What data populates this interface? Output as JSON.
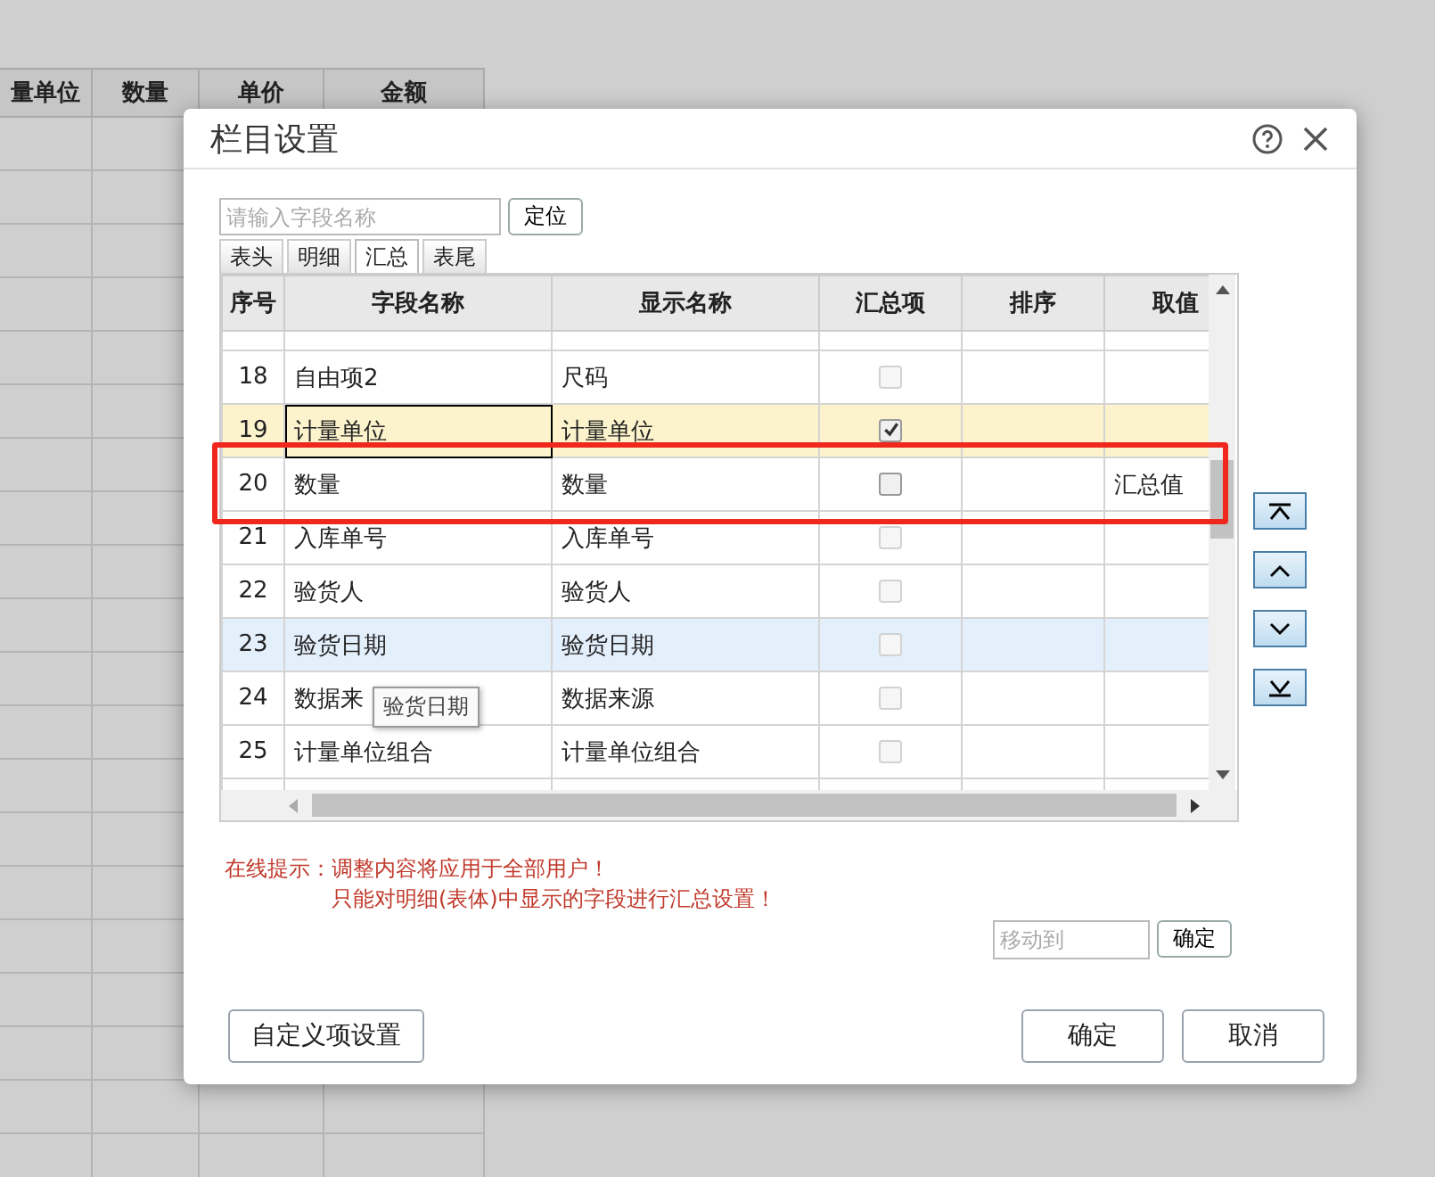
{
  "background_sheet": {
    "columns": [
      "量单位",
      "数量",
      "单价",
      "金额"
    ]
  },
  "dialog": {
    "title": "栏目设置"
  },
  "search": {
    "placeholder": "请输入字段名称",
    "button": "定位"
  },
  "tabs": [
    {
      "label": "表头",
      "selected": false
    },
    {
      "label": "明细",
      "selected": false
    },
    {
      "label": "汇总",
      "selected": true
    },
    {
      "label": "表尾",
      "selected": false
    }
  ],
  "table": {
    "columns": [
      "序号",
      "字段名称",
      "显示名称",
      "汇总项",
      "排序",
      "取值"
    ],
    "rows": [
      {
        "no": "18",
        "field": "自由项2",
        "display": "尺码",
        "checked": false,
        "disabled": true,
        "value": "",
        "selected": false,
        "hovered": false
      },
      {
        "no": "19",
        "field": "计量单位",
        "display": "计量单位",
        "checked": true,
        "disabled": false,
        "value": "",
        "selected": true,
        "hovered": false
      },
      {
        "no": "20",
        "field": "数量",
        "display": "数量",
        "checked": false,
        "disabled": false,
        "value": "汇总值",
        "selected": false,
        "hovered": false
      },
      {
        "no": "21",
        "field": "入库单号",
        "display": "入库单号",
        "checked": false,
        "disabled": true,
        "value": "",
        "selected": false,
        "hovered": false
      },
      {
        "no": "22",
        "field": "验货人",
        "display": "验货人",
        "checked": false,
        "disabled": true,
        "value": "",
        "selected": false,
        "hovered": false
      },
      {
        "no": "23",
        "field": "验货日期",
        "display": "验货日期",
        "checked": false,
        "disabled": true,
        "value": "",
        "selected": false,
        "hovered": true
      },
      {
        "no": "24",
        "field": "数据来",
        "display": "数据来源",
        "checked": false,
        "disabled": true,
        "value": "",
        "selected": false,
        "hovered": false
      },
      {
        "no": "25",
        "field": "计量单位组合",
        "display": "计量单位组合",
        "checked": false,
        "disabled": true,
        "value": "",
        "selected": false,
        "hovered": false
      }
    ]
  },
  "tooltip": "验货日期",
  "hints": [
    "在线提示：调整内容将应用于全部用户！",
    "只能对明细(表体)中显示的字段进行汇总设置！"
  ],
  "move_to": {
    "placeholder": "移动到",
    "button": "确定"
  },
  "buttons": {
    "custom": "自定义项设置",
    "ok": "确定",
    "cancel": "取消"
  }
}
